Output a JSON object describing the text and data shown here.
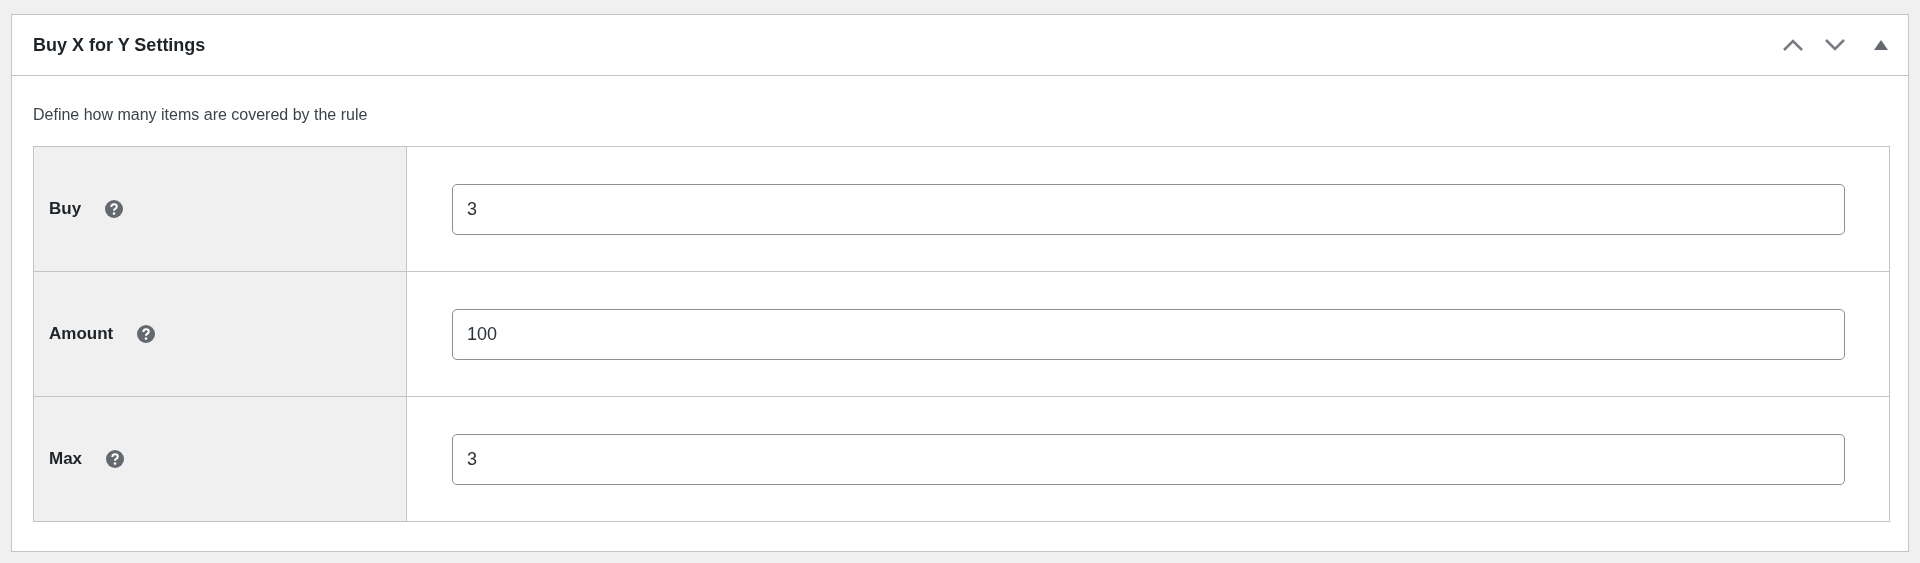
{
  "panel": {
    "title": "Buy X for Y Settings",
    "description": "Define how many items are covered by the rule",
    "expanded": true
  },
  "fields": [
    {
      "label": "Buy",
      "value": "3"
    },
    {
      "label": "Amount",
      "value": "100"
    },
    {
      "label": "Max",
      "value": "3"
    }
  ]
}
